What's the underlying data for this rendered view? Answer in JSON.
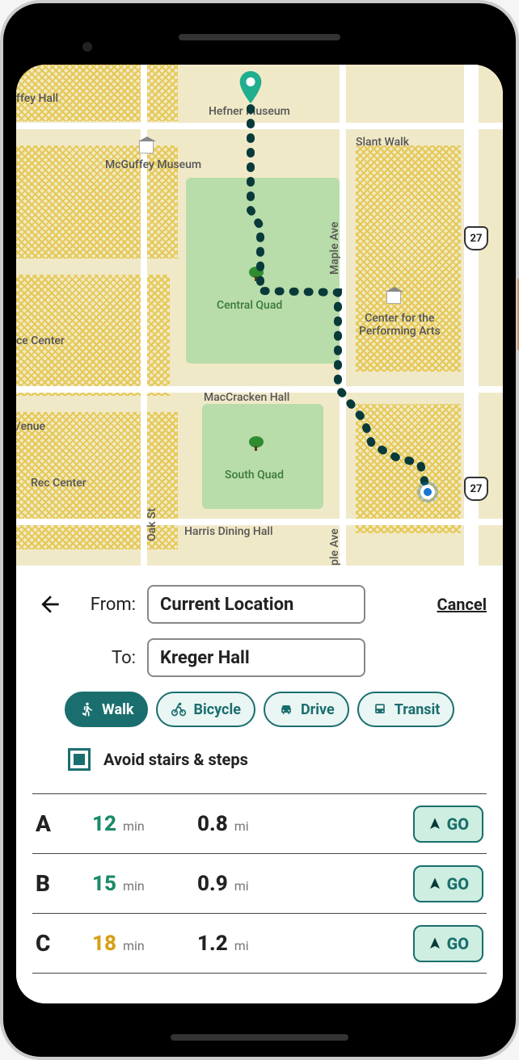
{
  "form": {
    "from_label": "From:",
    "to_label": "To:",
    "from_value": "Current Location",
    "to_value": "Kreger Hall",
    "cancel": "Cancel"
  },
  "modes": {
    "walk": "Walk",
    "bicycle": "Bicycle",
    "drive": "Drive",
    "transit": "Transit",
    "active": "walk"
  },
  "avoid": {
    "label": "Avoid stairs & steps",
    "checked": true
  },
  "routes": [
    {
      "letter": "A",
      "time": "12",
      "time_unit": "min",
      "dist": "0.8",
      "dist_unit": "mi",
      "go": "GO",
      "time_class": "time-best"
    },
    {
      "letter": "B",
      "time": "15",
      "time_unit": "min",
      "dist": "0.9",
      "dist_unit": "mi",
      "go": "GO",
      "time_class": "time-ok"
    },
    {
      "letter": "C",
      "time": "18",
      "time_unit": "min",
      "dist": "1.2",
      "dist_unit": "mi",
      "go": "GO",
      "time_class": "time-slow"
    }
  ],
  "map": {
    "labels": {
      "hefner": "Hefner Museum",
      "mcguffey": "McGuffey Museum",
      "slant_walk": "Slant Walk",
      "central_quad": "Central Quad",
      "south_quad": "South Quad",
      "maccracken": "MacCracken Hall",
      "harris": "Harris Dining Hall",
      "performing": "Center for the\nPerforming Arts",
      "rec": "Rec Center",
      "ice": "ce Center",
      "venue": "/enue",
      "oak": "Oak St",
      "maple": "Maple Ave",
      "ffey": "ffey Hall",
      "ple": "ple Ave"
    },
    "highway": "27"
  }
}
